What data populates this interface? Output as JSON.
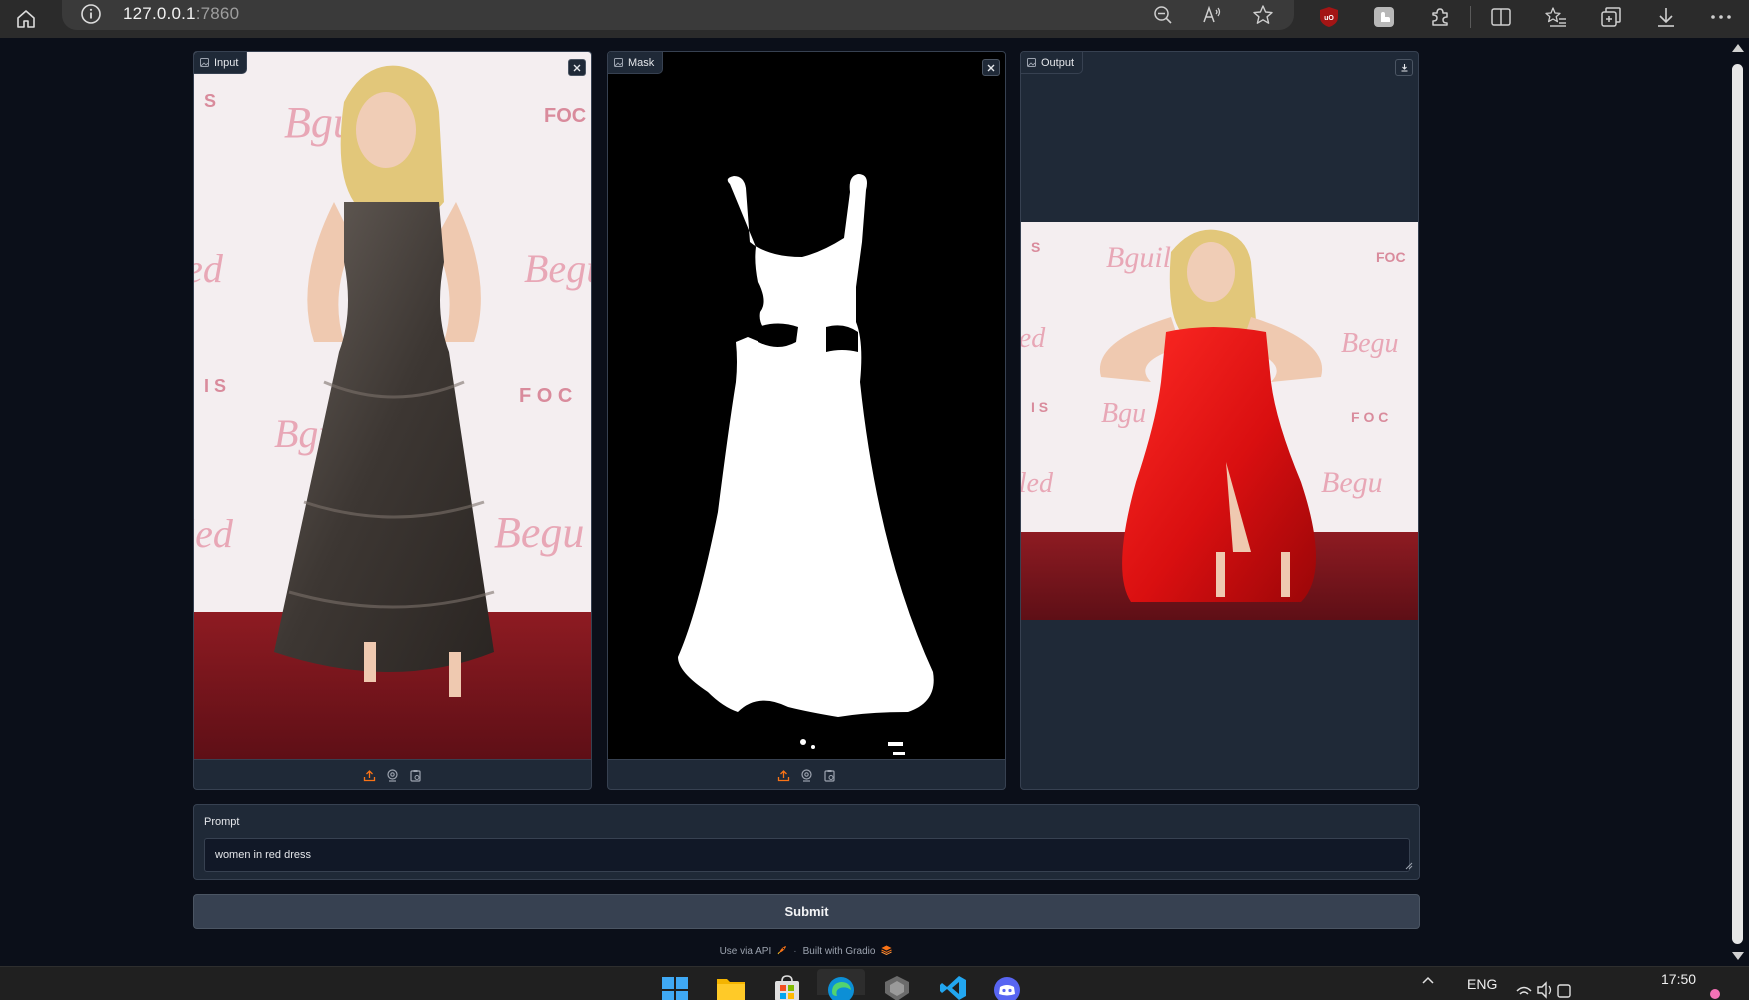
{
  "browser": {
    "url_host": "127.0.0.1",
    "url_port": ":7860"
  },
  "panels": {
    "input": {
      "label": "Input"
    },
    "mask": {
      "label": "Mask"
    },
    "output": {
      "label": "Output"
    }
  },
  "prompt": {
    "label": "Prompt",
    "value": "women in red dress"
  },
  "submit": {
    "label": "Submit"
  },
  "footer": {
    "api_label": "Use via API",
    "separator": "·",
    "built_label": "Built with Gradio"
  },
  "taskbar": {
    "language": "ENG",
    "time": "17:50"
  },
  "colors": {
    "page_bg": "#0b0f19",
    "panel_bg": "#1f2937",
    "border": "#374151",
    "accent_orange": "#f97316"
  }
}
